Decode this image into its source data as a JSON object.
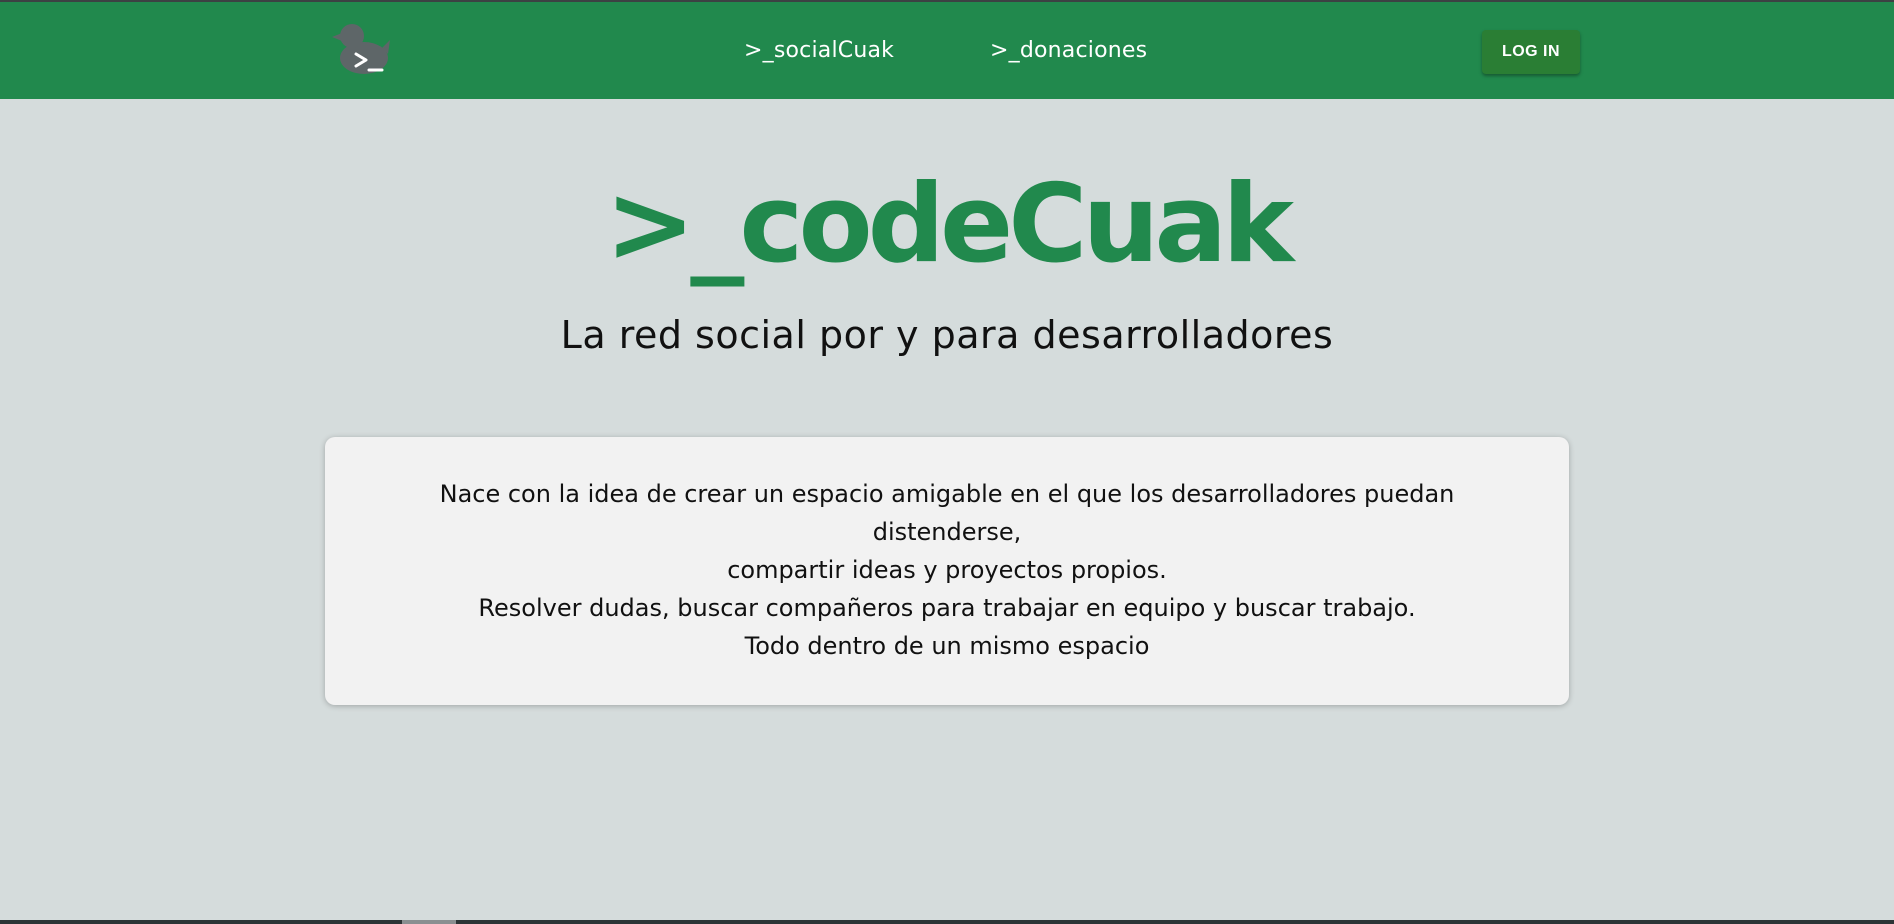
{
  "navbar": {
    "logo_icon": "duck-terminal-logo-icon",
    "links": [
      {
        "label": ">_socialCuak"
      },
      {
        "label": ">_donaciones"
      }
    ],
    "login_label": "LOG IN"
  },
  "hero": {
    "title": ">_codeCuak",
    "subtitle": "La red social por y para desarrolladores"
  },
  "card": {
    "lines": [
      "Nace con la idea de crear un espacio amigable en el que los desarrolladores puedan distenderse,",
      "compartir ideas y proyectos propios.",
      "Resolver dudas, buscar compañeros para trabajar en equipo y buscar trabajo.",
      "Todo dentro de un mismo espacio"
    ]
  },
  "colors": {
    "brand_green": "#21894d",
    "login_green": "#2a7e34",
    "background": "#d5dcdc",
    "card": "#f2f2f2"
  }
}
